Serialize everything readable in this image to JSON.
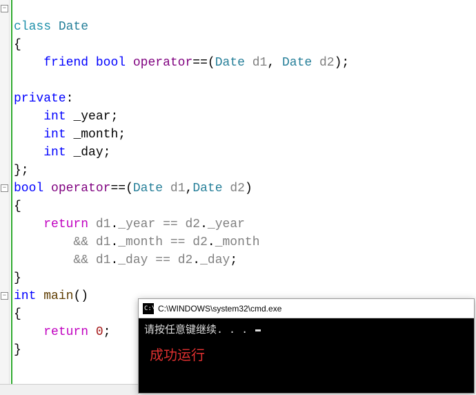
{
  "code": {
    "line1_class": "class",
    "line1_ident": "Date",
    "line2_brace": "{",
    "line3_friend": "friend",
    "line3_bool": "bool",
    "line3_operator": "operator",
    "line3_eq": "==",
    "line3_open": "(",
    "line3_t1": "Date",
    "line3_p1": "d1",
    "line3_comma": ", ",
    "line3_t2": "Date",
    "line3_p2": "d2",
    "line3_close": ");",
    "line5_private": "private",
    "line5_colon": ":",
    "line6_int": "int",
    "line6_var": "_year",
    "line6_semi": ";",
    "line7_int": "int",
    "line7_var": "_month",
    "line7_semi": ";",
    "line8_int": "int",
    "line8_var": "_day",
    "line8_semi": ";",
    "line9_end": "};",
    "line10_bool": "bool",
    "line10_operator": "operator",
    "line10_eq": "==",
    "line10_open": "(",
    "line10_t1": "Date",
    "line10_p1": "d1",
    "line10_comma": ",",
    "line10_t2": "Date",
    "line10_p2": "d2",
    "line10_close": ")",
    "line11_brace": "{",
    "line12_return": "return",
    "line12_d1": "d1",
    "line12_dot1": ".",
    "line12_m1": "_year",
    "line12_eq": " == ",
    "line12_d2": "d2",
    "line12_dot2": ".",
    "line12_m2": "_year",
    "line13_and": "&& ",
    "line13_d1": "d1",
    "line13_dot1": ".",
    "line13_m1": "_month",
    "line13_eq": " == ",
    "line13_d2": "d2",
    "line13_dot2": ".",
    "line13_m2": "_month",
    "line14_and": "&& ",
    "line14_d1": "d1",
    "line14_dot1": ".",
    "line14_m1": "_day",
    "line14_eq": " == ",
    "line14_d2": "d2",
    "line14_dot2": ".",
    "line14_m2": "_day",
    "line14_semi": ";",
    "line15_brace": "}",
    "line16_int": "int",
    "line16_main": "main",
    "line16_paren": "()",
    "line17_brace": "{",
    "line18_return": "return",
    "line18_zero": "0",
    "line18_semi": ";",
    "line19_brace": "}"
  },
  "console": {
    "icon_text": "C:\\",
    "title": "C:\\WINDOWS\\system32\\cmd.exe",
    "prompt": "请按任意键继续. . . ",
    "success": "成功运行"
  },
  "fold_glyph": "−"
}
